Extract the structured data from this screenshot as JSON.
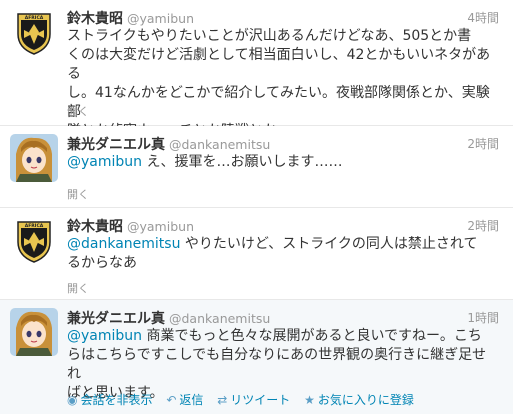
{
  "colors": {
    "link": "#0084b4",
    "meta": "#999999",
    "text": "#333333",
    "divider": "#e8e8e8"
  },
  "tweets": [
    {
      "name": "鈴木貴昭",
      "handle": "@yamibun",
      "time": "4時間",
      "line1": "ストライクもやりたいことが沢山あるんだけどなあ、505とか書",
      "line2": "くのは大変だけど活劇として相当面白いし、42とかもいいネタがある",
      "line3": "し。41なんかをどこかで紹介してみたい。夜戦部隊関係とか、実験部",
      "line4": "隊とか偵察ウィッチとか陸戦とか",
      "expand": "開く",
      "avatar": "badge-avatar"
    },
    {
      "name": "兼光ダニエル真",
      "handle": "@dankanemitsu",
      "time": "2時間",
      "mention": "@yamibun",
      "line1": " え、援軍を…お願いします……",
      "expand": "開く",
      "avatar": "anime-girl-avatar"
    },
    {
      "name": "鈴木貴昭",
      "handle": "@yamibun",
      "time": "2時間",
      "mention": "@dankanemitsu",
      "line1": " やりたいけど、ストライクの同人は禁止されて",
      "line2": "るからなあ",
      "expand": "開く",
      "avatar": "badge-avatar"
    },
    {
      "name": "兼光ダニエル真",
      "handle": "@dankanemitsu",
      "time": "1時間",
      "mention": "@yamibun",
      "line1": " 商業でもっと色々な展開があると良いですねー。こち",
      "line2": "らはこちらですこしでも自分なりにあの世界観の奥行きに継ぎ足せれ",
      "line3": "ばと思います。",
      "avatar": "anime-girl-avatar",
      "actions": [
        {
          "label": "会話を非表示",
          "icon": "conversation-icon"
        },
        {
          "label": "返信",
          "icon": "reply-icon"
        },
        {
          "label": "リツイート",
          "icon": "retweet-icon"
        },
        {
          "label": "お気に入りに登録",
          "icon": "star-icon"
        }
      ]
    }
  ]
}
